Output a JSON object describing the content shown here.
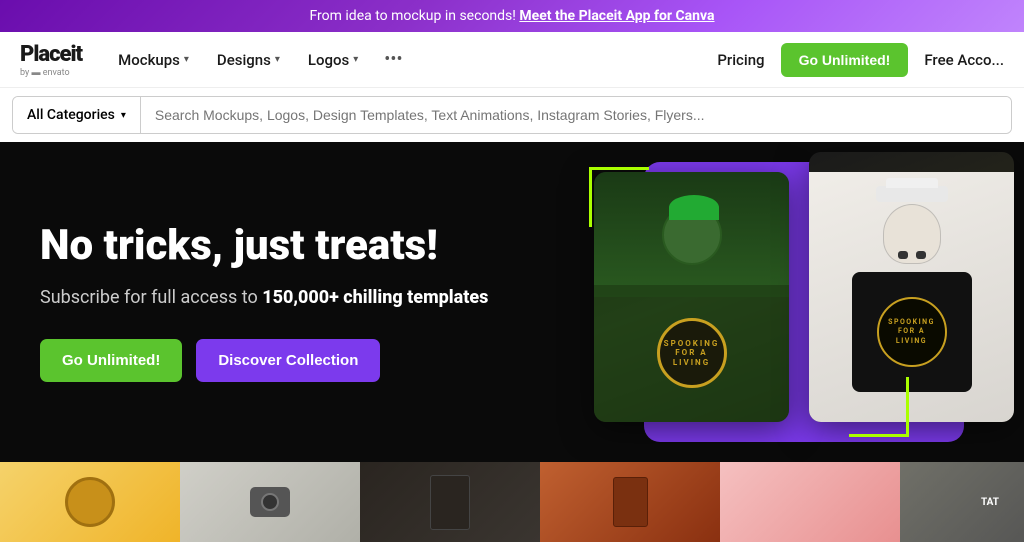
{
  "banner": {
    "text": "From idea to mockup in seconds!",
    "link_text": "Meet the Placeit App for Canva"
  },
  "navbar": {
    "logo": "Placeit",
    "logo_by": "by  envato",
    "mockups_label": "Mockups",
    "designs_label": "Designs",
    "logos_label": "Logos",
    "pricing_label": "Pricing",
    "go_unlimited_label": "Go Unlimited!",
    "free_account_label": "Free Acco..."
  },
  "search": {
    "category_label": "All Categories",
    "placeholder": "Search Mockups, Logos, Design Templates, Text Animations, Instagram Stories, Flyers..."
  },
  "hero": {
    "title": "No tricks, just treats!",
    "subtitle_plain": "Subscribe for full access to ",
    "subtitle_bold": "150,000+ chilling templates",
    "btn_unlimited": "Go Unlimited!",
    "btn_discover": "Discover Collection"
  },
  "snake_logo_text": "SPOOKING\nFOR A\nLIVING",
  "bottom_strip": {
    "items": [
      "yellow-preview",
      "camera-preview",
      "dark-preview",
      "brown-preview",
      "pink-preview",
      "gray-preview"
    ]
  }
}
